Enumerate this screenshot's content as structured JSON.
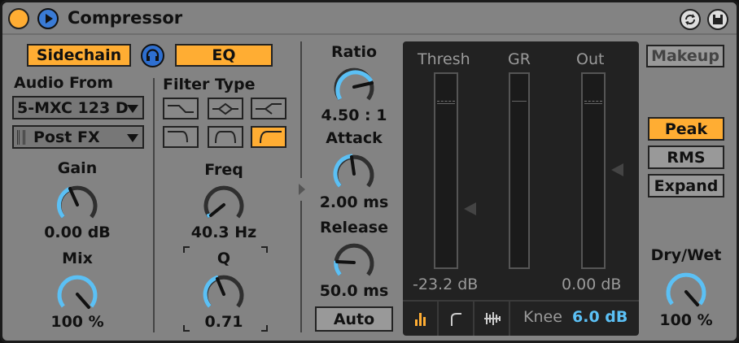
{
  "title": "Compressor",
  "sidechain_label": "Sidechain",
  "eq_label": "EQ",
  "audio_from_label": "Audio From",
  "audio_from_value": "5-MXC 123 D",
  "post_fx_value": "Post FX",
  "gain": {
    "label": "Gain",
    "value": "0.00 dB"
  },
  "mix": {
    "label": "Mix",
    "value": "100 %"
  },
  "filter_type_label": "Filter Type",
  "freq": {
    "label": "Freq",
    "value": "40.3 Hz"
  },
  "q": {
    "label": "Q",
    "value": "0.71"
  },
  "ratio": {
    "label": "Ratio",
    "value": "4.50 : 1"
  },
  "attack": {
    "label": "Attack",
    "value": "2.00 ms"
  },
  "release": {
    "label": "Release",
    "value": "50.0 ms"
  },
  "auto_label": "Auto",
  "graph": {
    "thresh_label": "Thresh",
    "gr_label": "GR",
    "out_label": "Out",
    "thresh_value": "-23.2 dB",
    "out_value": "0.00 dB",
    "knee_label": "Knee",
    "knee_value": "6.0 dB"
  },
  "makeup_label": "Makeup",
  "peak_label": "Peak",
  "rms_label": "RMS",
  "expand_label": "Expand",
  "drywet": {
    "label": "Dry/Wet",
    "value": "100 %"
  },
  "colors": {
    "accent": "#ffad33",
    "knob_arc": "#5bc0f5",
    "panel": "#838383",
    "knee_value": "#5bc0f5"
  }
}
